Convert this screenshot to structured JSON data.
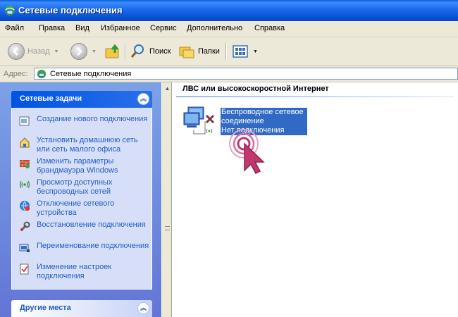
{
  "window": {
    "title": "Сетевые подключения"
  },
  "menu": [
    "Файл",
    "Правка",
    "Вид",
    "Избранное",
    "Сервис",
    "Дополнительно",
    "Справка"
  ],
  "toolbar": {
    "back_label": "Назад",
    "search_label": "Поиск",
    "folders_label": "Папки"
  },
  "address": {
    "label": "Адрес:",
    "value": "Сетевые подключения"
  },
  "tasks_panel": {
    "title": "Сетевые задачи",
    "items": [
      {
        "icon": "new-connection-icon",
        "label": "Создание нового подключения"
      },
      {
        "icon": "home-network-icon",
        "label": "Установить домашнюю сеть или сеть малого офиса"
      },
      {
        "icon": "firewall-icon",
        "label": "Изменить параметры брандмауэра Windows"
      },
      {
        "icon": "wireless-networks-icon",
        "label": "Просмотр доступных беспроводных сетей"
      },
      {
        "icon": "disable-device-icon",
        "label": "Отключение сетевого устройства"
      },
      {
        "icon": "repair-icon",
        "label": "Восстановление подключения"
      },
      {
        "icon": "rename-icon",
        "label": "Переименование подключения"
      },
      {
        "icon": "settings-icon",
        "label": "Изменение настроек подключения"
      }
    ]
  },
  "other_places_panel": {
    "title": "Другие места"
  },
  "content": {
    "group_title": "ЛВС или высокоскоростной Интернет",
    "connection": {
      "line1": "Беспроводное сетевое",
      "line2": "соединение",
      "status": "Нет подключения"
    }
  },
  "colors": {
    "title_bar": "#0a56d8",
    "task_pane": "#6f8fe0",
    "selection": "#316ac5",
    "cursor": "#c0386e"
  }
}
